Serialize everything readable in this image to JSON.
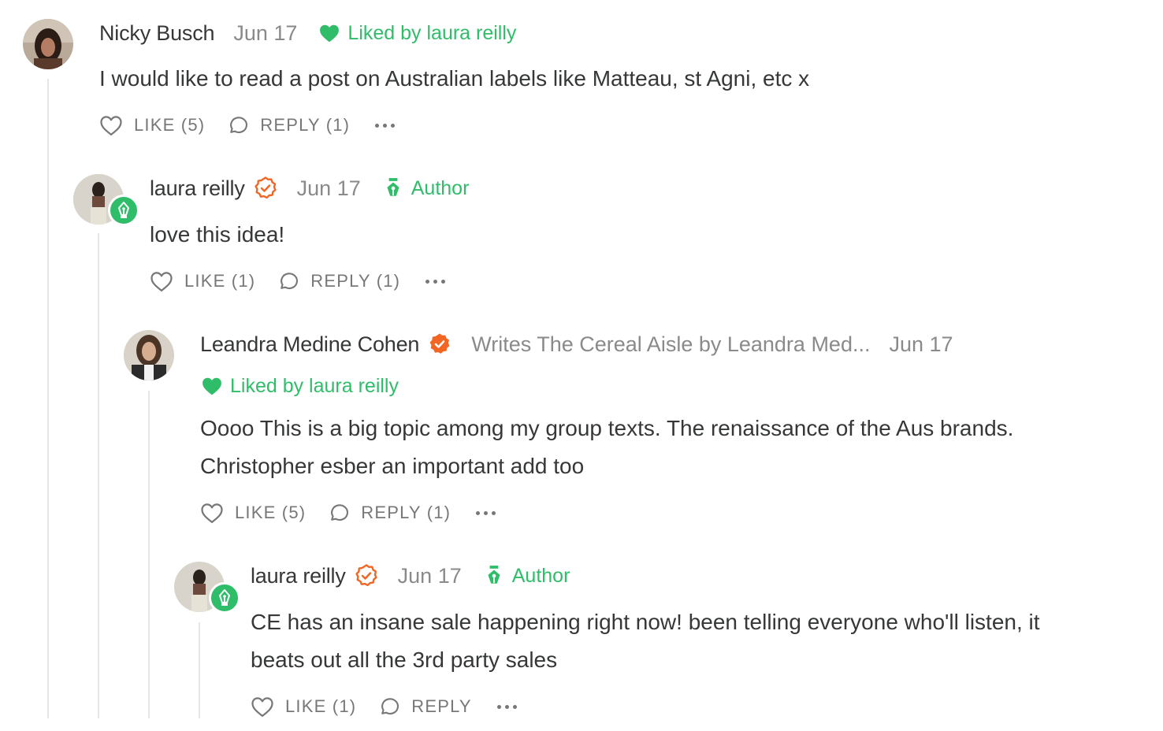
{
  "colors": {
    "accent_green": "#2fbd6a",
    "verified_orange": "#f26522",
    "text": "#363737",
    "muted": "#8a8a8a"
  },
  "comments": [
    {
      "name": "Nicky Busch",
      "date": "Jun 17",
      "liked_by": "Liked by laura reilly",
      "body": "I would like to read a post on Australian labels like Matteau, st Agni, etc x",
      "actions": {
        "like": "LIKE (5)",
        "reply": "REPLY (1)"
      },
      "icons": {
        "like": "heart-outline-icon",
        "reply": "speech-bubble-icon",
        "more": "ellipsis-icon",
        "liked": "heart-filled-icon"
      }
    },
    {
      "name": "laura reilly",
      "verified": true,
      "date": "Jun 17",
      "author_label": "Author",
      "body": "love this idea!",
      "actions": {
        "like": "LIKE (1)",
        "reply": "REPLY (1)"
      },
      "icons": {
        "verified": "check-circle-outline-icon",
        "author": "pen-nib-icon"
      }
    },
    {
      "name": "Leandra Medine Cohen",
      "verified": true,
      "writes": "Writes The Cereal Aisle by Leandra Med...",
      "date": "Jun 17",
      "liked_by": "Liked by laura reilly",
      "body_lines": [
        "Oooo This is a big topic among my group texts. The renaissance of the Aus brands.",
        "Christopher esber an important add too"
      ],
      "actions": {
        "like": "LIKE (5)",
        "reply": "REPLY (1)"
      },
      "icons": {
        "verified": "check-circle-filled-icon"
      }
    },
    {
      "name": "laura reilly",
      "verified": true,
      "date": "Jun 17",
      "author_label": "Author",
      "body_lines": [
        "CE has an insane sale happening right now! been telling everyone who'll listen, it",
        "beats out all the 3rd party sales"
      ],
      "actions": {
        "like": "LIKE (1)",
        "reply": "REPLY"
      }
    }
  ]
}
